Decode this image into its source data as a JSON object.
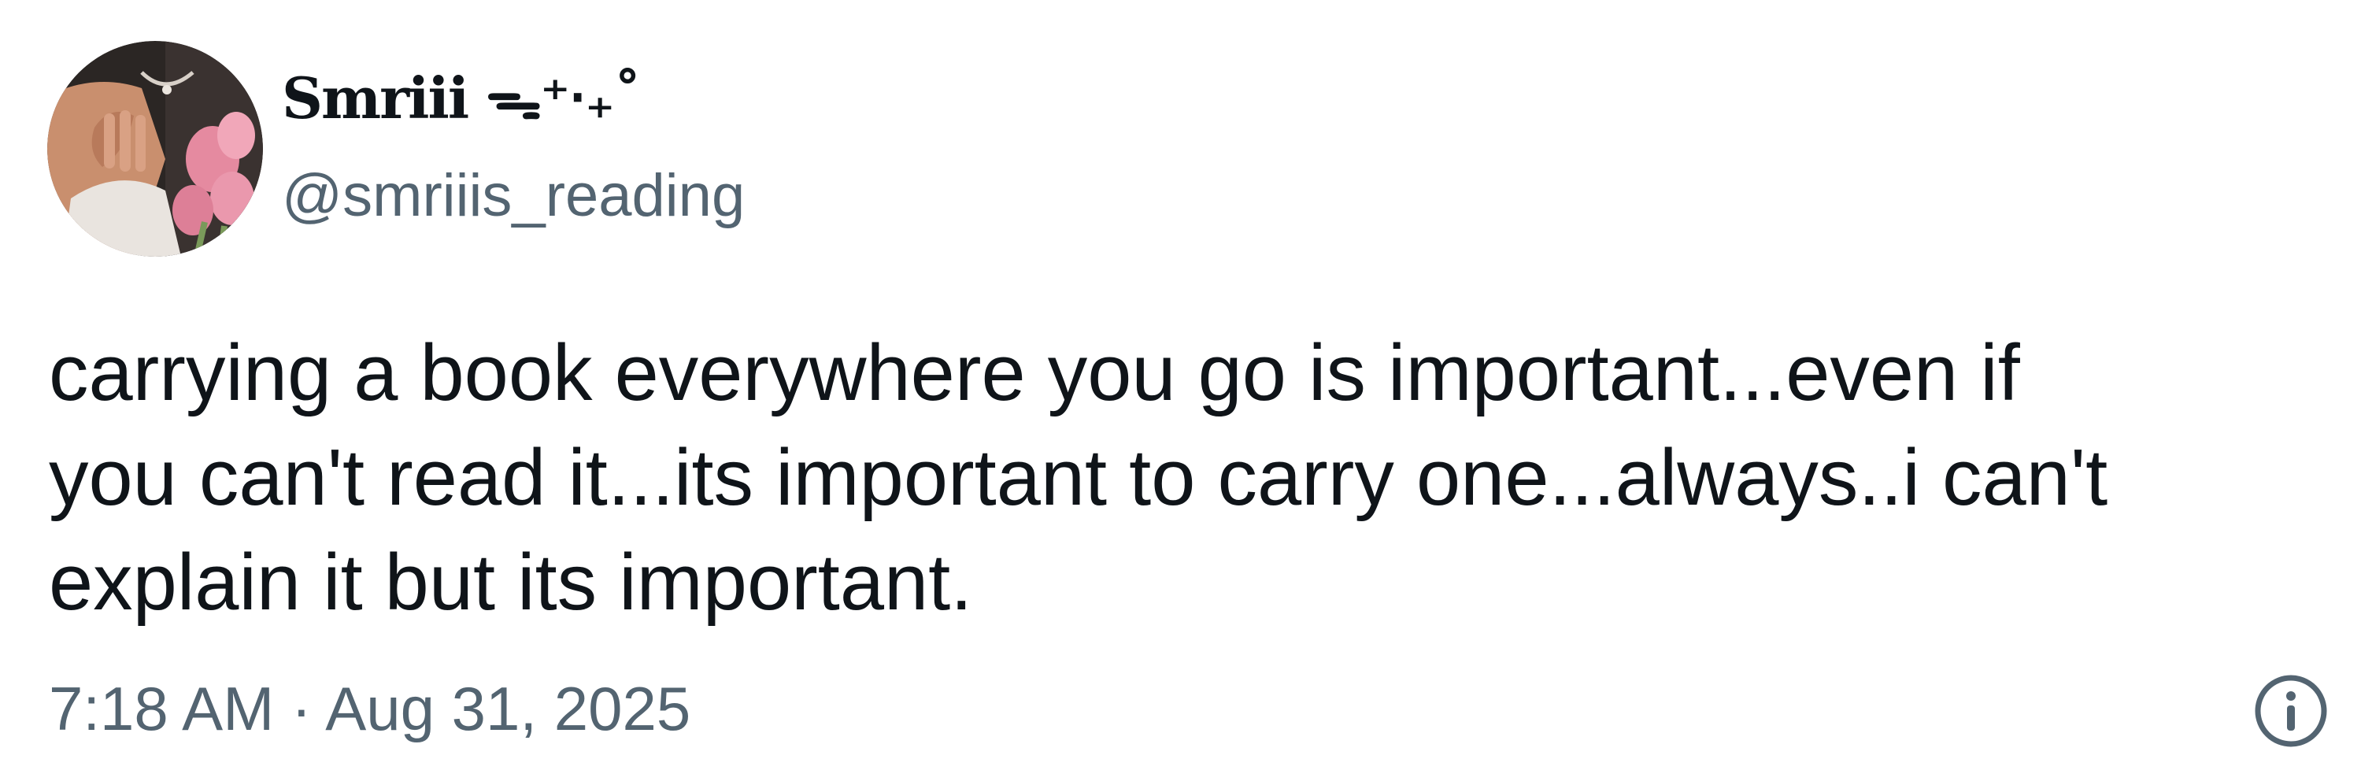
{
  "tweet": {
    "author": {
      "display_name": "Smriii ᯓ⁺‧₊˚",
      "handle": "@smriiis_reading"
    },
    "text": "carrying a book everywhere you go is important...even if\nyou can't read it...its important to carry one...always..i can't\nexplain it but its important.",
    "timestamp": "7:18 AM · Aug 31, 2025",
    "icons": {
      "avatar": "profile-photo",
      "info": "info-icon"
    },
    "colors": {
      "text": "#0f1419",
      "secondary": "#536471",
      "background": "#ffffff"
    }
  }
}
